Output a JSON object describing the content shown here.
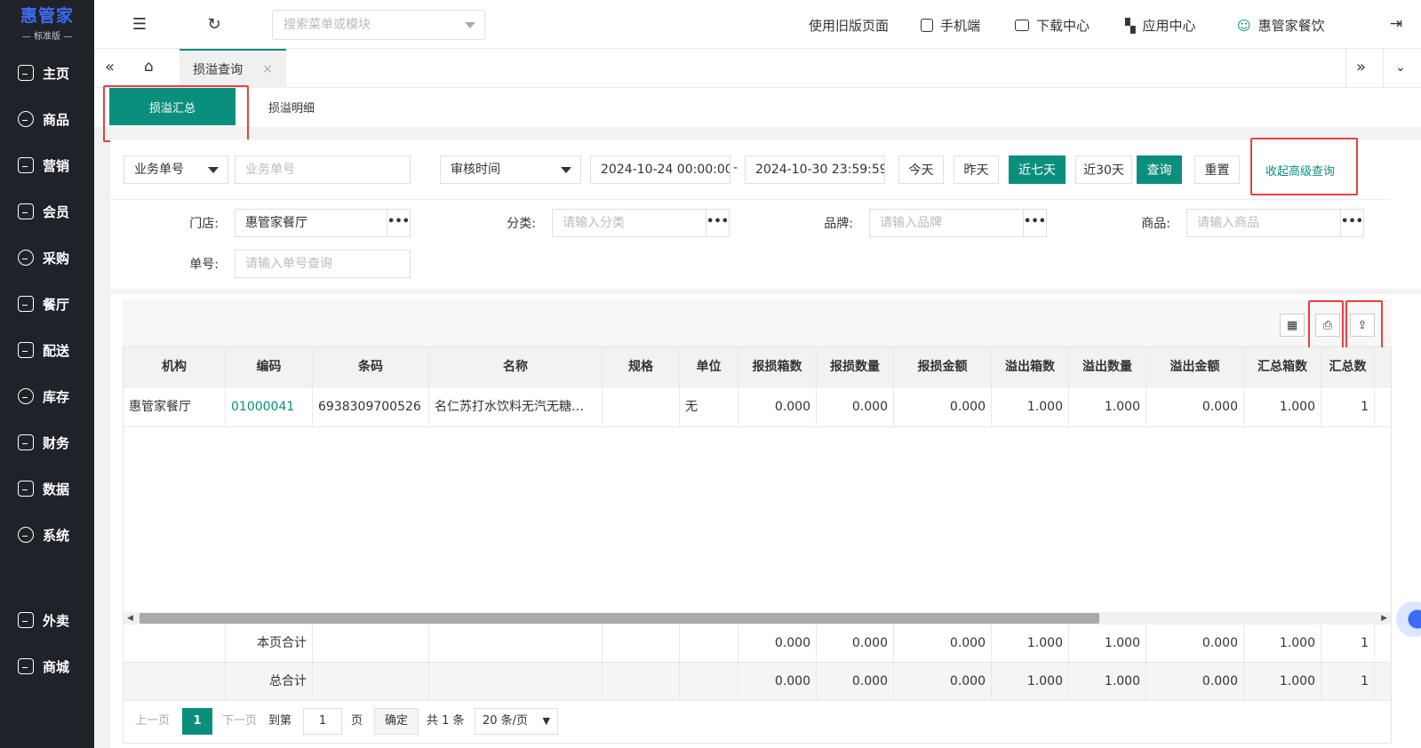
{
  "sidebar": {
    "logo_main": "惠管家",
    "logo_sub": "— 标准版 —",
    "items": [
      {
        "label": "主页",
        "icon": "home-icon"
      },
      {
        "label": "商品",
        "icon": "box-icon"
      },
      {
        "label": "营销",
        "icon": "chart-icon"
      },
      {
        "label": "会员",
        "icon": "heart-icon"
      },
      {
        "label": "采购",
        "icon": "cart-icon"
      },
      {
        "label": "餐厅",
        "icon": "restaurant-icon"
      },
      {
        "label": "配送",
        "icon": "delivery-icon"
      },
      {
        "label": "库存",
        "icon": "inventory-icon"
      },
      {
        "label": "财务",
        "icon": "finance-icon"
      },
      {
        "label": "数据",
        "icon": "data-icon"
      },
      {
        "label": "系统",
        "icon": "settings-icon"
      },
      {
        "label": "外卖",
        "icon": "takeaway-icon"
      },
      {
        "label": "商城",
        "icon": "store-icon"
      }
    ]
  },
  "topbar": {
    "search_placeholder": "搜索菜单或模块",
    "old_page": "使用旧版页面",
    "mobile": "手机端",
    "download": "下载中心",
    "apps": "应用中心",
    "user": "惠管家餐饮"
  },
  "tabs": {
    "current": "损溢查询",
    "close": "×"
  },
  "subtabs": {
    "summary": "损溢汇总",
    "detail": "损溢明细"
  },
  "filters": {
    "bizno_select": "业务单号",
    "bizno_placeholder": "业务单号",
    "time_select": "审核时间",
    "date_from": "2024-10-24 00:00:00",
    "date_sep": "-",
    "date_to": "2024-10-30 23:59:59",
    "today": "今天",
    "yesterday": "昨天",
    "last7": "近七天",
    "last30": "近30天",
    "query": "查询",
    "reset": "重置",
    "collapse_advanced": "收起高级查询",
    "store_label": "门店:",
    "store_value": "惠管家餐厅",
    "category_label": "分类:",
    "category_placeholder": "请输入分类",
    "brand_label": "品牌:",
    "brand_placeholder": "请输入品牌",
    "product_label": "商品:",
    "product_placeholder": "请输入商品",
    "order_label": "单号:",
    "order_placeholder": "请输入单号查询",
    "dots": "•••"
  },
  "table": {
    "columns": [
      "机构",
      "编码",
      "条码",
      "名称",
      "规格",
      "单位",
      "报损箱数",
      "报损数量",
      "报损金额",
      "溢出箱数",
      "溢出数量",
      "溢出金额",
      "汇总箱数",
      "汇总数"
    ],
    "rows": [
      [
        "惠管家餐厅",
        "01000041",
        "6938309700526",
        "名仁苏打水饮料无汽无糖…",
        "",
        "无",
        "0.000",
        "0.000",
        "0.000",
        "1.000",
        "1.000",
        "0.000",
        "1.000",
        "1"
      ]
    ],
    "page_total": [
      "",
      "本页合计",
      "",
      "",
      "",
      "",
      "0.000",
      "0.000",
      "0.000",
      "1.000",
      "1.000",
      "0.000",
      "1.000",
      "1"
    ],
    "grand_total": [
      "",
      "总合计",
      "",
      "",
      "",
      "",
      "0.000",
      "0.000",
      "0.000",
      "1.000",
      "1.000",
      "0.000",
      "1.000",
      "1"
    ]
  },
  "pager": {
    "prev": "上一页",
    "current": "1",
    "next": "下一页",
    "goto": "到第",
    "goto_value": "1",
    "page_unit": "页",
    "confirm": "确定",
    "total": "共 1 条",
    "page_size": "20 条/页"
  },
  "colors": {
    "accent": "#0b8f7d",
    "sidebar": "#1f2229",
    "highlight": "#e8403f"
  }
}
